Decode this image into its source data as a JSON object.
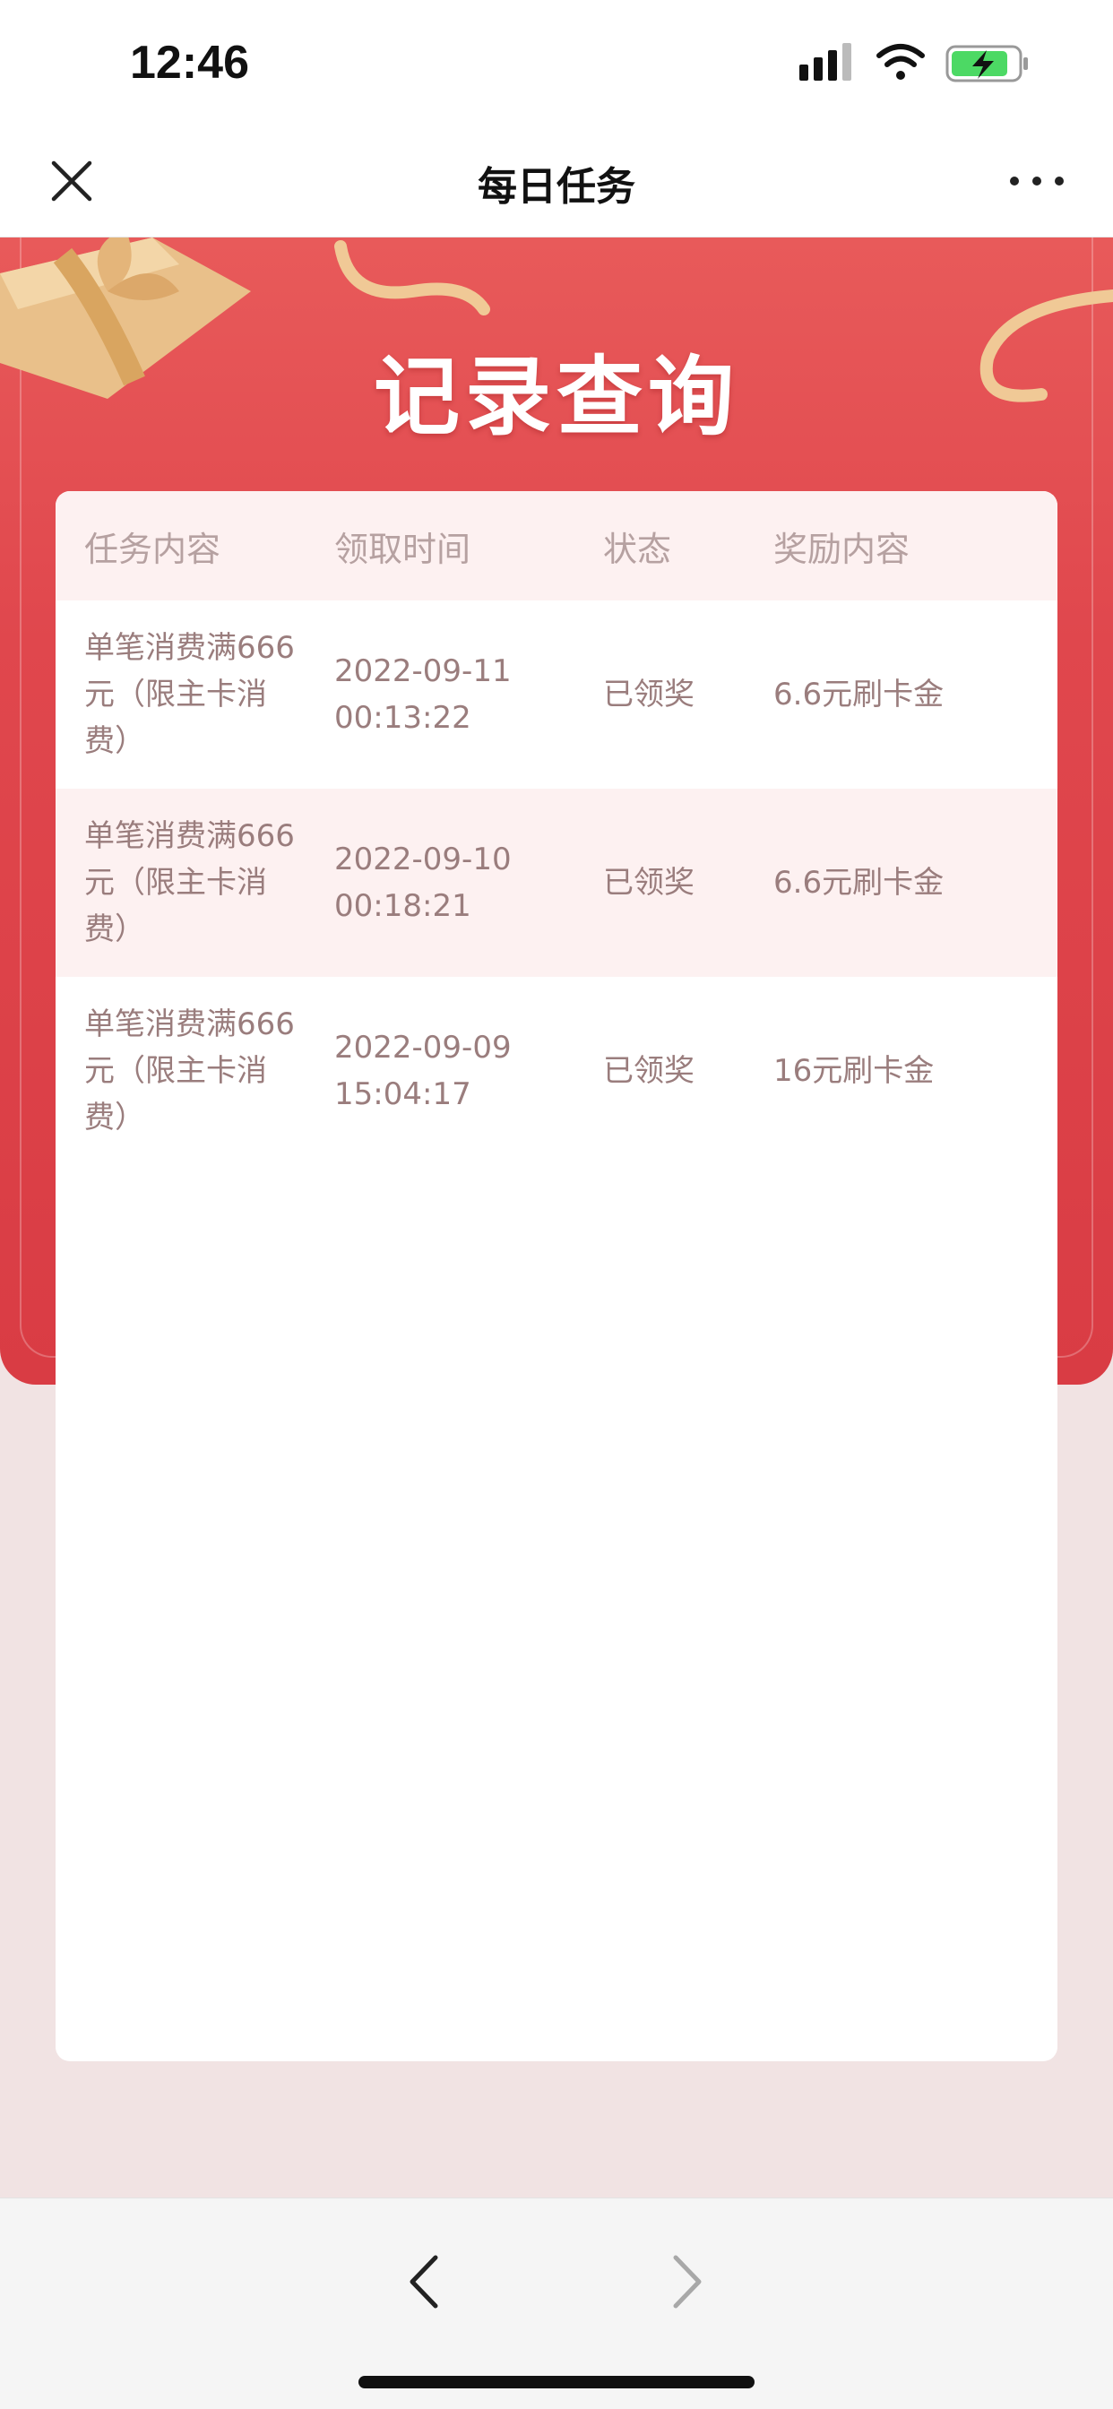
{
  "status_bar": {
    "time": "12:46"
  },
  "nav": {
    "title": "每日任务"
  },
  "hero": {
    "title": "记录查询"
  },
  "table": {
    "headers": [
      "任务内容",
      "领取时间",
      "状态",
      "奖励内容"
    ],
    "rows": [
      {
        "task_line1": "单笔消费满666",
        "task_line2": "元（限主卡消",
        "task_line3": "费）",
        "date": "2022-09-11",
        "time": "00:13:22",
        "status": "已领奖",
        "reward": "6.6元刷卡金"
      },
      {
        "task_line1": "单笔消费满666",
        "task_line2": "元（限主卡消",
        "task_line3": "费）",
        "date": "2022-09-10",
        "time": "00:18:21",
        "status": "已领奖",
        "reward": "6.6元刷卡金"
      },
      {
        "task_line1": "单笔消费满666",
        "task_line2": "元（限主卡消",
        "task_line3": "费）",
        "date": "2022-09-09",
        "time": "15:04:17",
        "status": "已领奖",
        "reward": "16元刷卡金"
      }
    ]
  },
  "colors": {
    "hero_red": "#e0474d",
    "row_tint": "#fdf1f1",
    "text_muted": "#9a7d7d"
  }
}
